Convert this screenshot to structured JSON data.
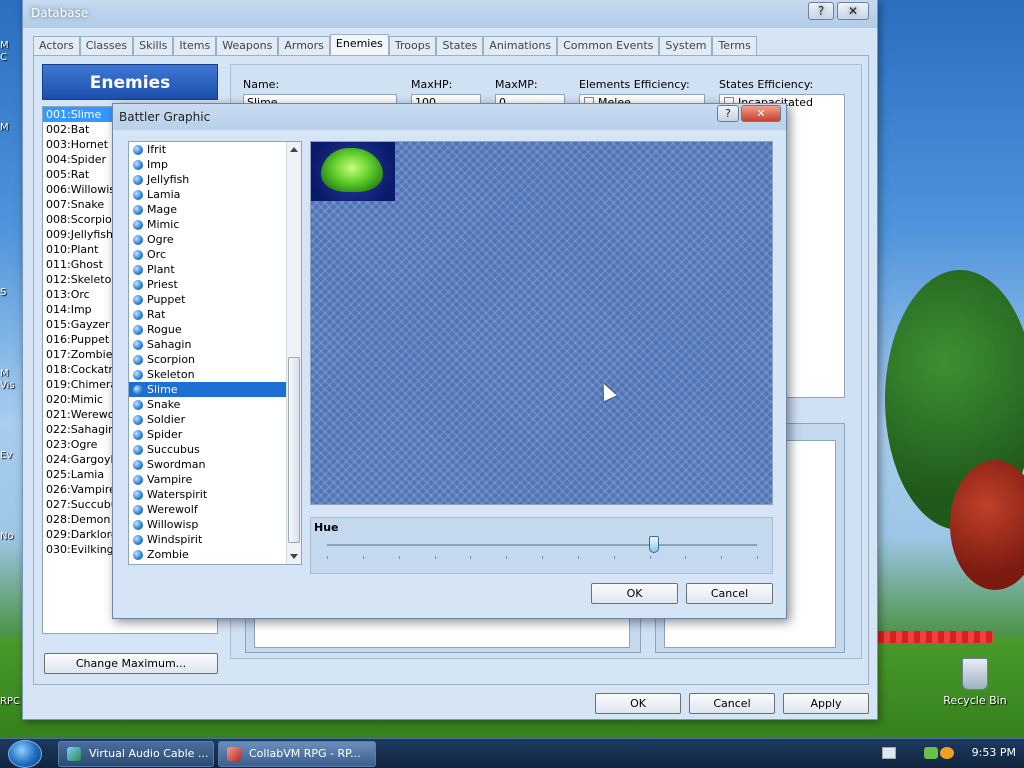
{
  "desktop": {
    "recycle_bin_label": "Recycle Bin",
    "edge_labels": [
      "M",
      "C",
      "M",
      "S",
      "M",
      "Vis",
      "Ev",
      "No",
      "RPC"
    ]
  },
  "database": {
    "title": "Database",
    "help_button": "?",
    "close_button": "✕",
    "tabs": [
      "Actors",
      "Classes",
      "Skills",
      "Items",
      "Weapons",
      "Armors",
      "Enemies",
      "Troops",
      "States",
      "Animations",
      "Common Events",
      "System",
      "Terms"
    ],
    "active_tab": "Enemies",
    "enemies_header": "Enemies",
    "enemies": [
      "001:Slime",
      "002:Bat",
      "003:Hornet",
      "004:Spider",
      "005:Rat",
      "006:Willowisp",
      "007:Snake",
      "008:Scorpion",
      "009:Jellyfish",
      "010:Plant",
      "011:Ghost",
      "012:Skeleton",
      "013:Orc",
      "014:Imp",
      "015:Gayzer",
      "016:Puppet",
      "017:Zombie",
      "018:Cockatrice",
      "019:Chimera",
      "020:Mimic",
      "021:Werewolf",
      "022:Sahagin",
      "023:Ogre",
      "024:Gargoyle",
      "025:Lamia",
      "026:Vampire",
      "027:Succubus",
      "028:Demon",
      "029:Darklord",
      "030:Evilking"
    ],
    "change_max_label": "Change Maximum...",
    "name_label": "Name:",
    "name_value": "Slime",
    "maxhp_label": "MaxHP:",
    "maxhp_value": "100",
    "maxmp_label": "MaxMP:",
    "maxmp_value": "0",
    "elements_label": "Elements Efficiency:",
    "elements_first": "Melee",
    "states_label": "States Efficiency:",
    "states_first": "Incapacitated",
    "ok_label": "OK",
    "cancel_label": "Cancel",
    "apply_label": "Apply"
  },
  "dialog": {
    "title": "Battler Graphic",
    "help_button": "?",
    "close_button": "✕",
    "graphics": [
      "Ifrit",
      "Imp",
      "Jellyfish",
      "Lamia",
      "Mage",
      "Mimic",
      "Ogre",
      "Orc",
      "Plant",
      "Priest",
      "Puppet",
      "Rat",
      "Rogue",
      "Sahagin",
      "Scorpion",
      "Skeleton",
      "Slime",
      "Snake",
      "Soldier",
      "Spider",
      "Succubus",
      "Swordman",
      "Vampire",
      "Waterspirit",
      "Werewolf",
      "Willowisp",
      "Windspirit",
      "Zombie"
    ],
    "selected_graphic": "Slime",
    "hue_label": "Hue",
    "hue_value": 0.76,
    "ok_label": "OK",
    "cancel_label": "Cancel"
  },
  "taskbar": {
    "tasks": [
      "Virtual Audio Cable ...",
      "CollabVM RPG - RP..."
    ],
    "clock": "9:53 PM"
  },
  "colors": {
    "selection": "#1d6fd6",
    "header_blue": "#2a5fc0"
  }
}
